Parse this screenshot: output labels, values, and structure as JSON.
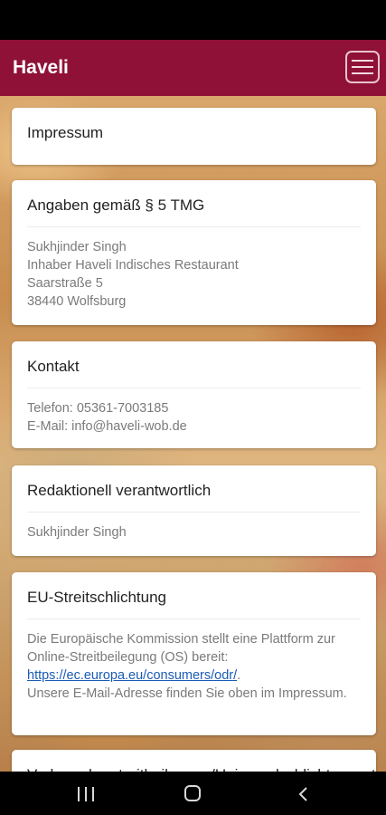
{
  "app": {
    "title": "Haveli",
    "brand_color": "#8f1138",
    "menu_icon": "hamburger-menu-icon"
  },
  "cards": [
    {
      "title": "Impressum"
    },
    {
      "title": "Angaben gemäß § 5 TMG",
      "lines": [
        "Sukhjinder Singh",
        "Inhaber Haveli Indisches Restaurant",
        "Saarstraße 5",
        "38440 Wolfsburg"
      ]
    },
    {
      "title": "Kontakt",
      "lines": [
        "Telefon: 05361-7003185",
        "E-Mail: info@haveli-wob.de"
      ]
    },
    {
      "title": "Redaktionell verantwortlich",
      "lines": [
        "Sukhjinder Singh"
      ]
    },
    {
      "title": "EU-Streitschlichtung",
      "text1": "Die Europäische Kommission stellt eine Plattform zur Online-Streitbeilegung (OS) bereit:",
      "link": "https://ec.europa.eu/consumers/odr/",
      "text2": ".",
      "text3": "Unsere E-Mail-Adresse finden Sie oben im Impressum."
    },
    {
      "title": "Verbraucherstreitbeilegung/Universalschlichtungsstelle"
    }
  ],
  "navigation": {
    "recents_icon": "recents-icon",
    "home_icon": "home-icon",
    "back_icon": "back-icon"
  }
}
